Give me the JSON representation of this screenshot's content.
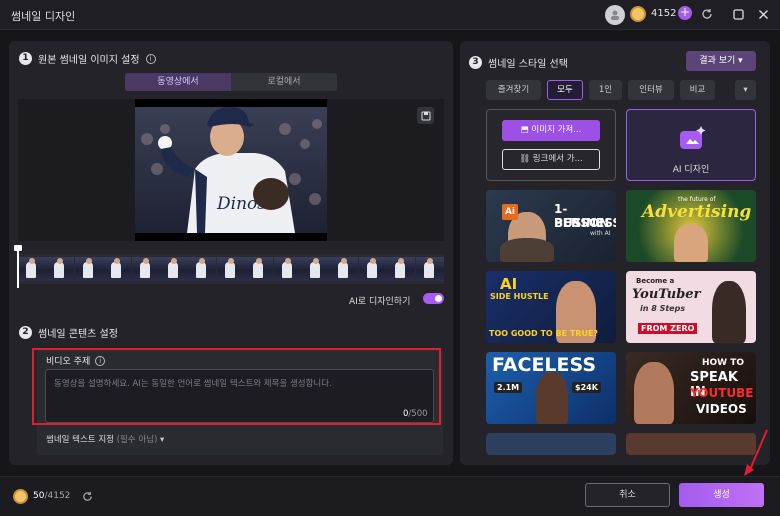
{
  "window": {
    "title": "썸네일 디자인",
    "credits": "4152"
  },
  "left": {
    "section1": {
      "num": "1",
      "title": "원본 썸네일 이미지 설정"
    },
    "source_tabs": [
      "동영상에서",
      "로컬에서"
    ],
    "ai_design_label": "AI로 디자인하기",
    "ai_design_on": true,
    "section2": {
      "num": "2",
      "title": "썸네일 콘텐츠 설정"
    },
    "video_topic": {
      "label": "비디오 주제",
      "placeholder": "동영상을 설명하세요. AI는 동일한 언어로 썸네일 텍스트와 제목을 생성합니다.",
      "count": "0",
      "max": "/500"
    },
    "thumb_text": {
      "label": "썸네일 텍스트 지정",
      "optional": "(필수 아님)"
    },
    "photo_jersey": "Dinos"
  },
  "right": {
    "section3": {
      "num": "3",
      "title": "썸네일 스타일 선택"
    },
    "result_button": "결과 보기",
    "filters": [
      "즐겨찾기",
      "모두",
      "1인",
      "인터뷰",
      "비교"
    ],
    "active_filter": "모두",
    "upload": {
      "image_btn": "이미지 가져...",
      "link_btn": "링크에서 가..."
    },
    "ai_card": "AI 디자인",
    "thumbs": [
      {
        "lines": [
          "1-PERSON",
          "BUSINESS",
          "with AI"
        ],
        "badge": "Ai"
      },
      {
        "lines": [
          "the future of",
          "Advertising"
        ]
      },
      {
        "lines": [
          "AI",
          "SIDE HUSTLE",
          "TOO GOOD TO BE TRUE?"
        ]
      },
      {
        "lines": [
          "Become a",
          "YouTuber",
          "in 8 Steps",
          "FROM ZERO"
        ]
      },
      {
        "lines": [
          "FACELESS",
          "2.1M",
          "$24K"
        ]
      },
      {
        "lines": [
          "HOW TO",
          "SPEAK IN",
          "YOUTUBE",
          "VIDEOS"
        ]
      }
    ]
  },
  "footer": {
    "used": "50",
    "total": "/4152",
    "cancel": "취소",
    "generate": "생성"
  },
  "colors": {
    "accent": "#a75bf2",
    "highlight": "#e01e2d"
  }
}
